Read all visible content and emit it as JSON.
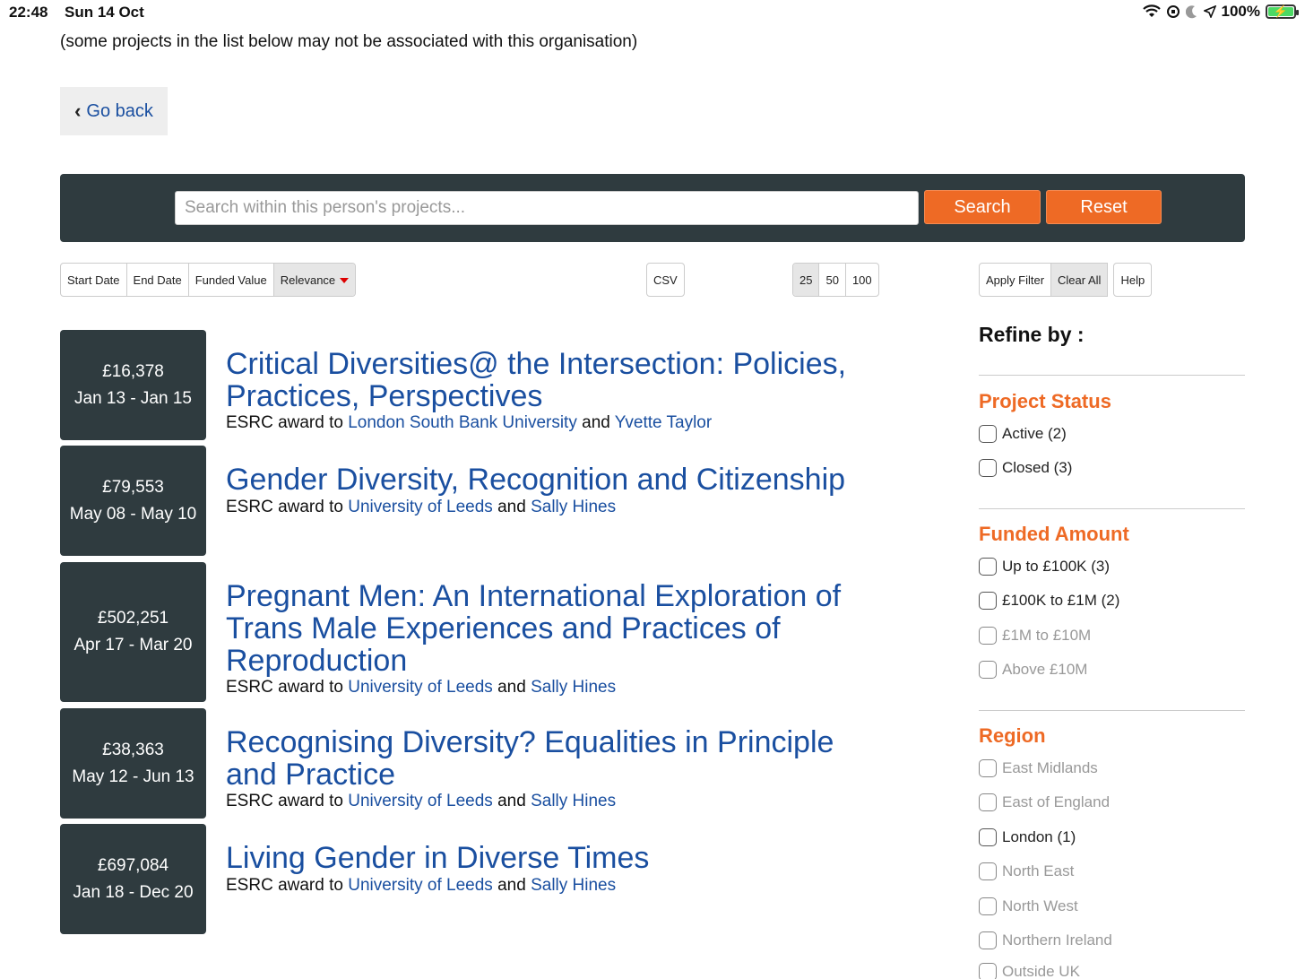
{
  "status_bar": {
    "time": "22:48",
    "date": "Sun 14 Oct",
    "battery": "100%"
  },
  "note": "(some projects in the list below may not be associated with this organisation)",
  "go_back": "Go back",
  "search": {
    "placeholder": "Search within this person's projects...",
    "search_label": "Search",
    "reset_label": "Reset"
  },
  "sort": [
    "Start Date",
    "End Date",
    "Funded Value",
    "Relevance"
  ],
  "export": "CSV",
  "page_sizes": [
    "25",
    "50",
    "100"
  ],
  "filter_actions": [
    "Apply Filter",
    "Clear All",
    "Help"
  ],
  "projects": [
    {
      "amount": "£16,378",
      "dates": "Jan 13 - Jan 15",
      "title": "Critical Diversities@ the Intersection: Policies, Practices, Perspectives",
      "award_prefix": "ESRC award to",
      "org": "London South Bank University",
      "and": "and",
      "person": "Yvette Taylor"
    },
    {
      "amount": "£79,553",
      "dates": "May 08 - May 10",
      "title": "Gender Diversity, Recognition and Citizenship",
      "award_prefix": "ESRC award to",
      "org": "University of Leeds",
      "and": "and",
      "person": "Sally Hines"
    },
    {
      "amount": "£502,251",
      "dates": "Apr 17 - Mar 20",
      "title": "Pregnant Men: An International Exploration of Trans Male Experiences and Practices of Reproduction",
      "award_prefix": "ESRC award to",
      "org": "University of Leeds",
      "and": "and",
      "person": "Sally Hines"
    },
    {
      "amount": "£38,363",
      "dates": "May 12 - Jun 13",
      "title": "Recognising Diversity? Equalities in Principle and Practice",
      "award_prefix": "ESRC award to",
      "org": "University of Leeds",
      "and": "and",
      "person": "Sally Hines"
    },
    {
      "amount": "£697,084",
      "dates": "Jan 18 - Dec 20",
      "title": "Living Gender in Diverse Times",
      "award_prefix": "ESRC award to",
      "org": "University of Leeds",
      "and": "and",
      "person": "Sally Hines"
    }
  ],
  "refine": {
    "heading": "Refine by :",
    "project_status": {
      "title": "Project Status",
      "options": [
        "Active (2)",
        "Closed (3)"
      ]
    },
    "funded_amount": {
      "title": "Funded Amount",
      "options": [
        "Up to £100K (3)",
        "£100K to £1M (2)",
        "£1M to £10M",
        "Above £10M"
      ]
    },
    "region": {
      "title": "Region",
      "options": [
        "East Midlands",
        "East of England",
        "London (1)",
        "North East",
        "North West",
        "Northern Ireland",
        "Outside UK"
      ]
    }
  },
  "colors": {
    "accent": "#ee6a25",
    "dark": "#2f3b3f",
    "link": "#1a4fa0"
  }
}
